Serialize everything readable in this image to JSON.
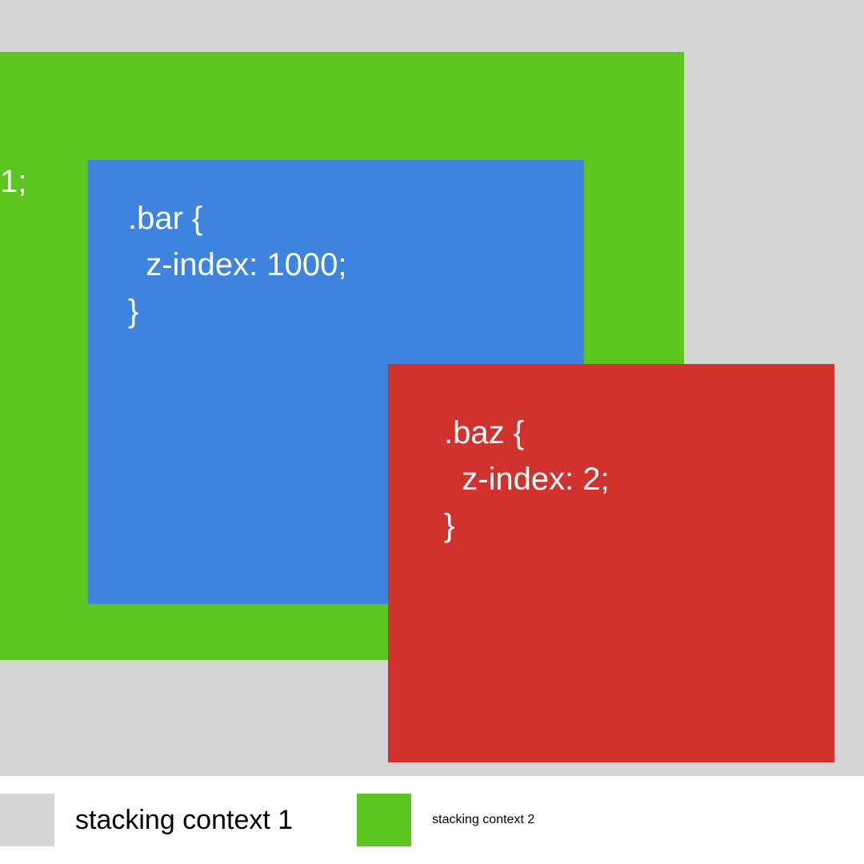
{
  "colors": {
    "background": "#d5d5d5",
    "green": "#5cc520",
    "blue": "#3e83de",
    "red": "#d2322d",
    "white": "#ffffff"
  },
  "boxes": {
    "green": {
      "label_fragment": "1;"
    },
    "blue": {
      "code": ".bar {\n  z-index: 1000;\n}"
    },
    "red": {
      "code": ".baz {\n  z-index: 2;\n}"
    }
  },
  "legend": {
    "item1": "stacking context 1",
    "item2": "stacking context 2"
  }
}
